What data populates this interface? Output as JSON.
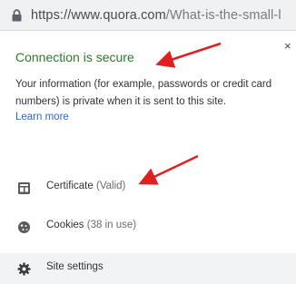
{
  "urlbar": {
    "url_main": "https://www.quora.com",
    "url_path": "/What-is-the-small-l"
  },
  "popup": {
    "close_glyph": "×",
    "title": "Connection is secure",
    "description": "Your information (for example, passwords or credit card numbers) is private when it is sent to this site.",
    "learn_more": "Learn more",
    "items": [
      {
        "label": "Certificate",
        "detail": "(Valid)",
        "icon": "certificate-icon"
      },
      {
        "label": "Cookies",
        "detail": "(38 in use)",
        "icon": "cookie-icon"
      },
      {
        "label": "Site settings",
        "detail": "",
        "icon": "gear-icon"
      }
    ]
  },
  "colors": {
    "secure_green": "#2b7a2b",
    "link_blue": "#3366cc",
    "annotation_red": "#e02020"
  }
}
